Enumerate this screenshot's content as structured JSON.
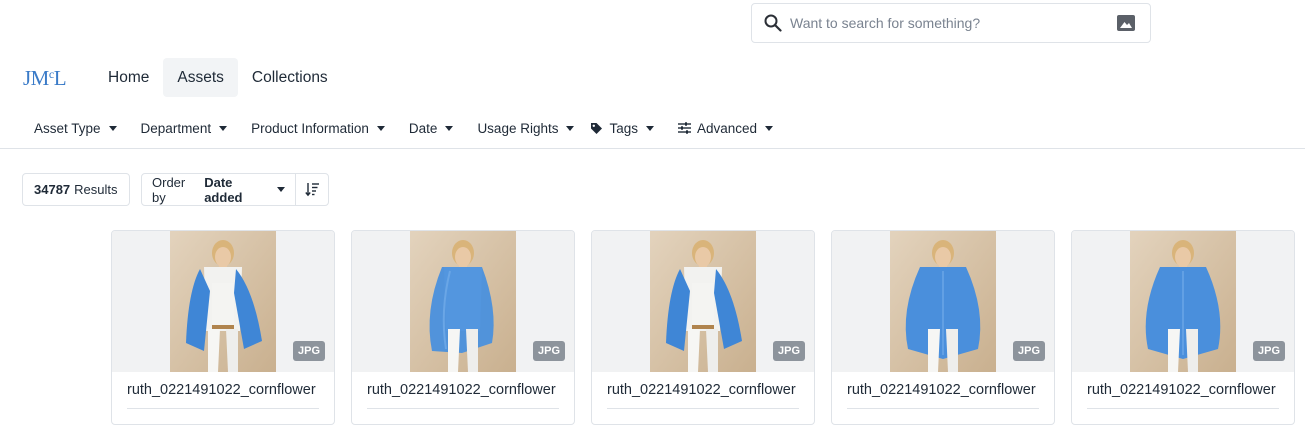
{
  "search": {
    "placeholder": "Want to search for something?"
  },
  "brand": {
    "logo_main": "JM",
    "logo_sup": "c",
    "logo_end": "L",
    "color": "#3a7bc8"
  },
  "nav": [
    {
      "label": "Home",
      "active": false
    },
    {
      "label": "Assets",
      "active": true
    },
    {
      "label": "Collections",
      "active": false
    }
  ],
  "filters": [
    {
      "label": "Asset Type",
      "icon": null
    },
    {
      "label": "Department",
      "icon": null
    },
    {
      "label": "Product Information",
      "icon": null
    },
    {
      "label": "Date",
      "icon": null
    },
    {
      "label": "Usage Rights",
      "icon": null
    },
    {
      "label": "Tags",
      "icon": "tag-icon"
    },
    {
      "label": "Advanced",
      "icon": "sliders-icon"
    }
  ],
  "results": {
    "count": "34787",
    "label": "Results"
  },
  "order": {
    "prefix": "Order by",
    "value": "Date added"
  },
  "cards": [
    {
      "name": "ruth_0221491022_cornflower",
      "type": "JPG",
      "pose": "front"
    },
    {
      "name": "ruth_0221491022_cornflower",
      "type": "JPG",
      "pose": "side"
    },
    {
      "name": "ruth_0221491022_cornflower",
      "type": "JPG",
      "pose": "front"
    },
    {
      "name": "ruth_0221491022_cornflower",
      "type": "JPG",
      "pose": "back"
    },
    {
      "name": "ruth_0221491022_cornflower",
      "type": "JPG",
      "pose": "back"
    }
  ]
}
